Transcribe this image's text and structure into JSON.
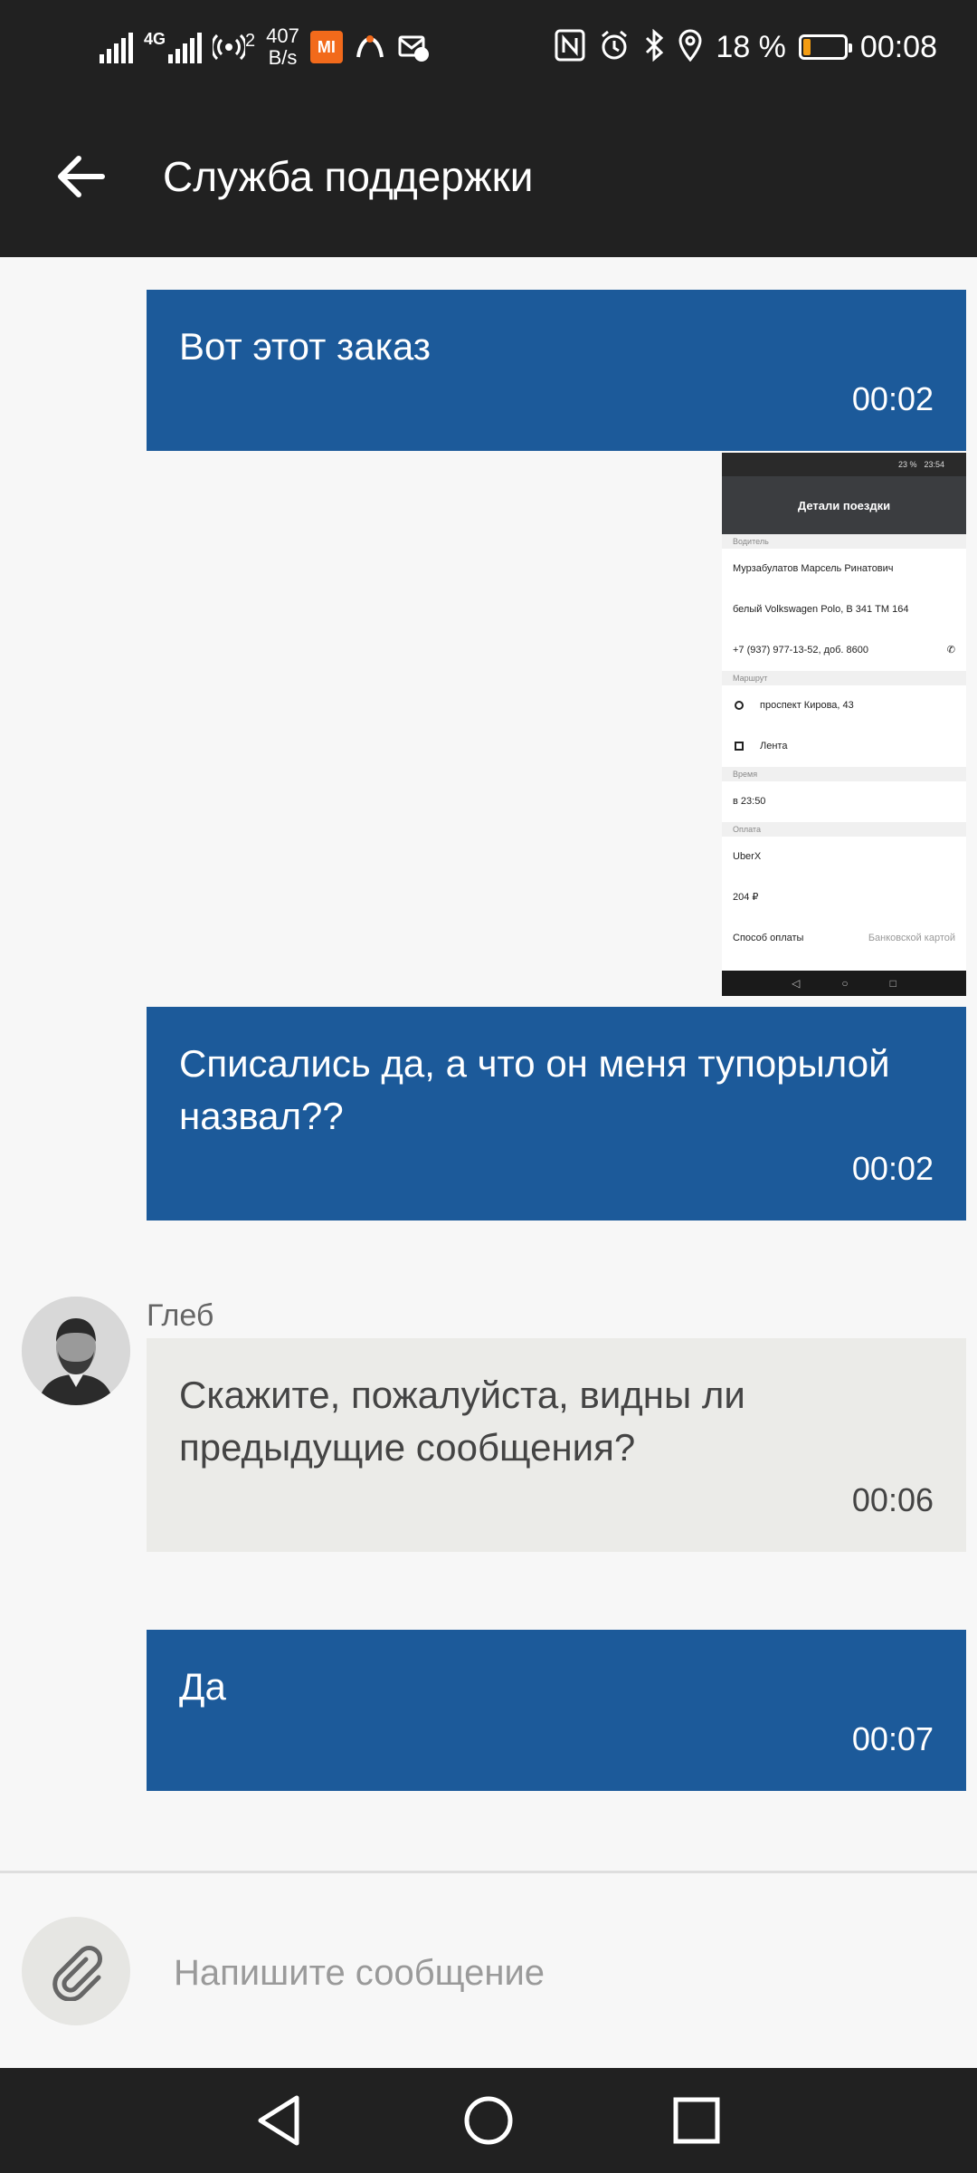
{
  "status_bar": {
    "network": "4G",
    "hotspot_count": "2",
    "net_speed_value": "407",
    "net_speed_unit": "B/s",
    "mi_label": "MI",
    "battery_text": "18 %",
    "battery_level": 0.18,
    "time": "00:08",
    "colors": {
      "mi_badge": "#f26a1b",
      "battery_fill": "#f39c12"
    }
  },
  "app_bar": {
    "title": "Служба поддержки"
  },
  "messages": [
    {
      "text": "Вот этот заказ",
      "time": "00:02",
      "direction": "outgoing"
    },
    {
      "text": "Списались да, а что он меня тупорылой назвал??",
      "time": "00:02",
      "direction": "outgoing"
    },
    {
      "sender": "Глеб",
      "text": "Скажите, пожалуйста, видны ли предыдущие сообщения?",
      "time": "00:06",
      "direction": "incoming"
    },
    {
      "text": "Да",
      "time": "00:07",
      "direction": "outgoing"
    }
  ],
  "attachment": {
    "status_time": "23:54",
    "status_battery": "23 %",
    "header": "Детали поездки",
    "driver_label": "Водитель",
    "driver_name": "Мурзабулатов Марсель Ринатович",
    "car": "белый Volkswagen Polo, В 341 ТМ 164",
    "phone": "+7 (937) 977-13-52, доб. 8600",
    "route_label": "Маршрут",
    "from": "проспект Кирова, 43",
    "to": "Лента",
    "time_label": "Время",
    "time_value": "в 23:50",
    "payment_label": "Оплата",
    "tariff": "UberX",
    "price": "204 ₽",
    "payment_method_label": "Способ оплаты",
    "payment_method_value": "Банковской картой"
  },
  "composer": {
    "placeholder": "Напишите сообщение"
  },
  "colors": {
    "outgoing_bubble": "#1c5a9a",
    "incoming_bubble": "#ebebe8",
    "bars": "#212121",
    "background": "#f7f7f7"
  }
}
